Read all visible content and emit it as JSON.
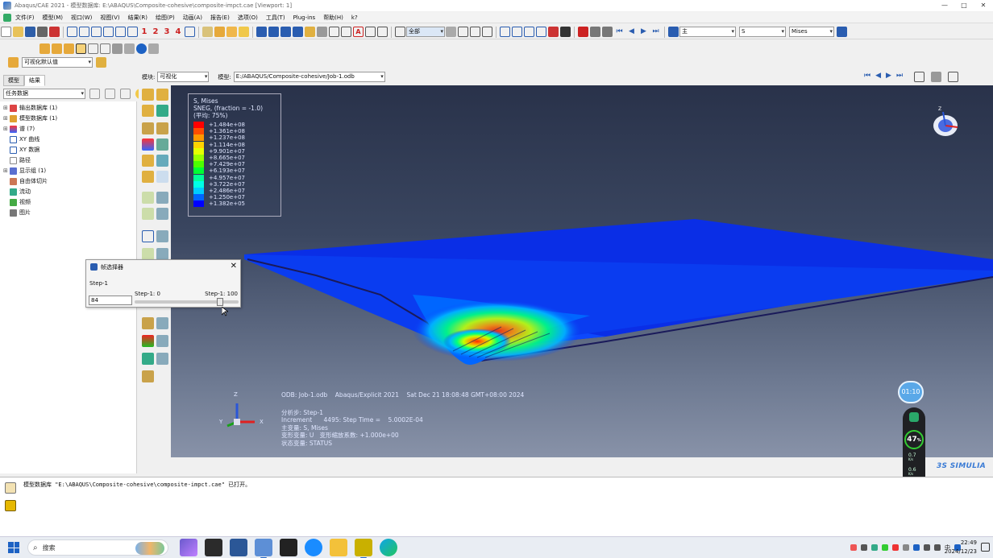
{
  "window": {
    "title": "Abaqus/CAE 2021 - 模型数据库: E:\\ABAQUS\\Composite-cohesive\\composite-impct.cae [Viewport: 1]",
    "controls": [
      "—",
      "□",
      "✕"
    ]
  },
  "menu": [
    "文件(F)",
    "模型(M)",
    "视口(W)",
    "视图(V)",
    "结果(R)",
    "绘图(P)",
    "动画(A)",
    "报告(E)",
    "选项(O)",
    "工具(T)",
    "Plug-ins",
    "帮助(H)",
    "k?"
  ],
  "toolbar": {
    "numbers": [
      "1",
      "2",
      "3",
      "4"
    ],
    "selection_combo": "全部",
    "step_combo": "主",
    "field_combo": "S",
    "invariant_combo": "Mises"
  },
  "context": {
    "defaults_combo": "可视化默认值",
    "module_label": "模块:",
    "module_value": "可视化",
    "model_label": "模型:",
    "model_value": "E:/ABAQUS/Composite-cohesive/Job-1.odb"
  },
  "left_panel": {
    "tabs": [
      "模型",
      "结果"
    ],
    "task_combo": "任务数据",
    "tree": [
      {
        "label": "输出数据库 (1)",
        "expand": "⊞"
      },
      {
        "label": "模型数据库 (1)",
        "expand": "⊞"
      },
      {
        "label": "谱 (7)",
        "expand": "⊞"
      },
      {
        "label": "XY 曲线",
        "expand": ""
      },
      {
        "label": "XY 数据",
        "expand": ""
      },
      {
        "label": "路径",
        "expand": ""
      },
      {
        "label": "显示组 (1)",
        "expand": "⊞"
      },
      {
        "label": "自由体切片",
        "expand": ""
      },
      {
        "label": "流动",
        "expand": ""
      },
      {
        "label": "视频",
        "expand": ""
      },
      {
        "label": "图片",
        "expand": ""
      }
    ]
  },
  "legend": {
    "title_lines": [
      "S, Mises",
      "SNEG, (fraction = -1.0)",
      "(平均: 75%)"
    ],
    "entries": [
      {
        "value": "+1.484e+08",
        "color": "#ff0000"
      },
      {
        "value": "+1.361e+08",
        "color": "#ff4d00"
      },
      {
        "value": "+1.237e+08",
        "color": "#ff9900"
      },
      {
        "value": "+1.114e+08",
        "color": "#ffd200"
      },
      {
        "value": "+9.901e+07",
        "color": "#e5ff00"
      },
      {
        "value": "+8.665e+07",
        "color": "#99ff00"
      },
      {
        "value": "+7.429e+07",
        "color": "#4cff00"
      },
      {
        "value": "+6.193e+07",
        "color": "#00ff33"
      },
      {
        "value": "+4.957e+07",
        "color": "#00ff99"
      },
      {
        "value": "+3.722e+07",
        "color": "#00ffe6"
      },
      {
        "value": "+2.486e+07",
        "color": "#00ccff"
      },
      {
        "value": "+1.250e+07",
        "color": "#0066ff"
      },
      {
        "value": "+1.382e+05",
        "color": "#0000ff"
      }
    ]
  },
  "viewport_info": {
    "odb_line": "ODB: Job-1.odb    Abaqus/Explicit 2021    Sat Dec 21 18:08:48 GMT+08:00 2024",
    "step": "分析步: Step-1",
    "increment": "Increment      4495: Step Time =    5.0002E-04",
    "primary": "主变量: S, Mises",
    "deformed": "变形变量: U   变形缩放系数: +1.000e+00",
    "status": "状态变量: STATUS"
  },
  "triad": {
    "x": "X",
    "y": "Y",
    "z": "Z"
  },
  "frame_dialog": {
    "title": "帧选择器",
    "step": "Step-1",
    "min_label": "Step-1: 0",
    "max_label": "Step-1: 100",
    "value": "84",
    "position": 0.84
  },
  "message": "模型数据库 \"E:\\ABAQUS\\Composite-cohesive\\composite-impct.cae\" 已打开。",
  "overlay": {
    "timer": "01:10",
    "percent": "47",
    "percent_unit": "%",
    "up_speed": "0.7",
    "down_speed": "0.6",
    "speed_unit": "K/s"
  },
  "brand": "3S SIMULIA",
  "taskbar": {
    "search_placeholder": "搜索",
    "time": "22:49",
    "date": "2024/12/23",
    "ime": "中"
  }
}
